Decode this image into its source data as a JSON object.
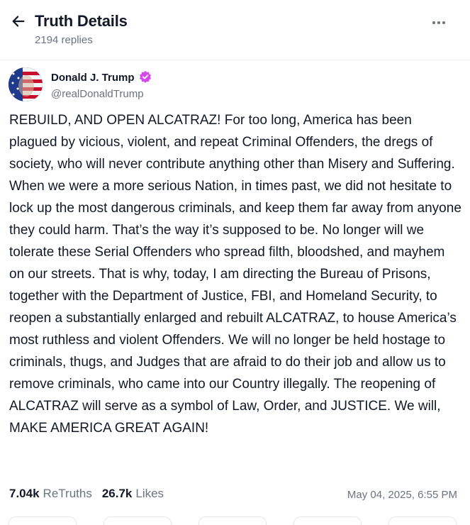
{
  "header": {
    "title": "Truth Details",
    "subtitle": "2194 replies",
    "back_icon": "arrow-left-icon",
    "more_icon": "more-horizontal-icon"
  },
  "post": {
    "author": {
      "name": "Donald J. Trump",
      "handle": "@realDonaldTrump",
      "verified": true,
      "verified_color": "#d946ef"
    },
    "text": "REBUILD, AND OPEN ALCATRAZ! For too long, America has been plagued by vicious, violent, and repeat Criminal Offenders, the dregs of society, who will never contribute anything other than Misery and Suffering. When we were a more serious Nation, in times past, we did not hesitate to lock up the most dangerous criminals, and keep them far away from anyone they could harm. That’s the way it’s supposed to be. No longer will we tolerate these Serial Offenders who spread filth, bloodshed, and mayhem on our streets. That is why, today, I am directing the Bureau of Prisons, together with the Department of Justice, FBI, and Homeland Security, to reopen a substantially enlarged and rebuilt ALCATRAZ, to house America’s most ruthless and violent Offenders. We will no longer be held hostage to criminals, thugs, and Judges that are afraid to do their job and allow us to remove criminals, who came into our Country illegally. The reopening of ALCATRAZ will serve as a symbol of Law, Order, and JUSTICE. We will, MAKE AMERICA GREAT AGAIN!",
    "retruths_count": "7.04k",
    "retruths_label": "ReTruths",
    "likes_count": "26.7k",
    "likes_label": "Likes",
    "timestamp": "May 04, 2025, 6:55 PM"
  }
}
